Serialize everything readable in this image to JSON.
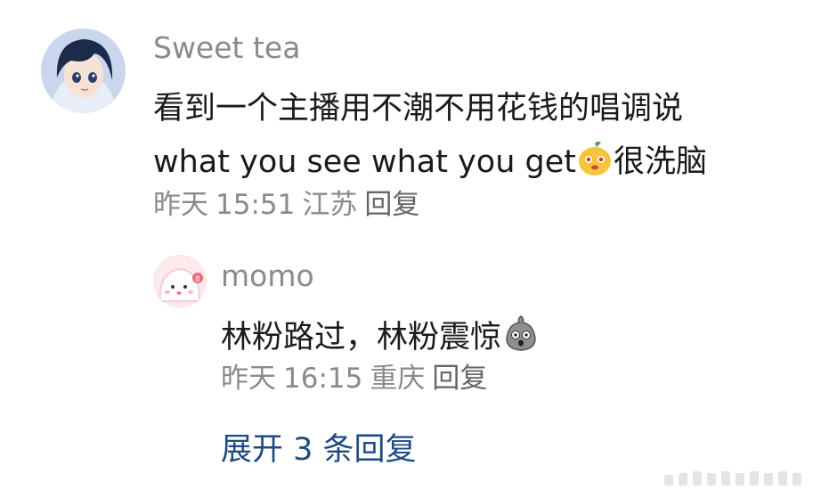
{
  "comment": {
    "user": "Sweet tea",
    "line1": "看到一个主播用不潮不用花钱的唱调说",
    "line2_text": "what you see what you get",
    "line2_emoji": "mango-face-emoji",
    "line2_tail": "很洗脑",
    "date": "昨天",
    "time": "15:51",
    "location": "江苏",
    "reply_label": "回复",
    "avatar": "anime-girl-avatar"
  },
  "reply": {
    "user": "momo",
    "text": "林粉路过，林粉震惊",
    "emoji": "shocked-rock-emoji",
    "date": "昨天",
    "time": "16:15",
    "location": "重庆",
    "reply_label": "回复",
    "avatar": "pink-blob-avatar"
  },
  "expand_label": "展开 3 条回复",
  "colors": {
    "text": "#1a1a1a",
    "muted": "#8a8a8a",
    "link": "#1f4b85"
  }
}
